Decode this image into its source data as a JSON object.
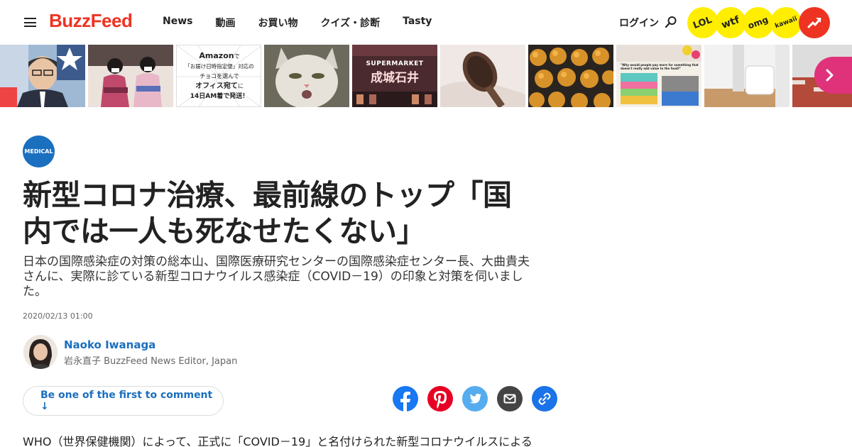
{
  "header": {
    "logo": "BuzzFeed",
    "nav": [
      "News",
      "動画",
      "お買い物",
      "クイズ・診断",
      "Tasty"
    ],
    "login": "ログイン",
    "badges": [
      "LOL",
      "wtf",
      "omg",
      "kawaii"
    ]
  },
  "strip": {
    "amazon_promo": {
      "line1": "Amazon",
      "line1_suffix": "で",
      "line2": "「お届け日時指定便」対応の",
      "line3": "チョコを選んで",
      "line4_strong": "オフィス宛て",
      "line4_suffix": "に",
      "line5": "14日AM着で発送！"
    },
    "supermarket": {
      "sign1": "SUPERMARKET",
      "sign2": "成城石井"
    },
    "quote": "\"Why would people pay more for something that doesn't really add value to the food?\""
  },
  "article": {
    "category": "MEDICAL",
    "headline_line1": "新型コロナ治療、最前線のトップ「国",
    "headline_line2": "内では一人も死なせたくない」",
    "dek_line1": "日本の国際感染症の対策の総本山、国際医療研究センターの国際感染症センター長、大曲貴夫",
    "dek_line2": "さんに、実際に診ている新型コロナウイルス感染症（COVID－19）の印象と対策を伺いまし",
    "dek_line3": "た。",
    "timestamp": "2020/02/13 01:00",
    "author_name": "Naoko Iwanaga",
    "author_title": "岩永直子 BuzzFeed News Editor, Japan",
    "comment_cta": "Be one of the first to comment ↓",
    "body_first_line": "WHO（世界保健機関）によって、正式に「COVID－19」と名付けられた新型コロナウイルスによる"
  },
  "colors": {
    "brand_red": "#ee3322",
    "link_blue": "#1a6fbf",
    "badge_yellow": "#ffee00",
    "facebook": "#1877f2",
    "pinterest": "#e60023",
    "twitter": "#55acee"
  }
}
